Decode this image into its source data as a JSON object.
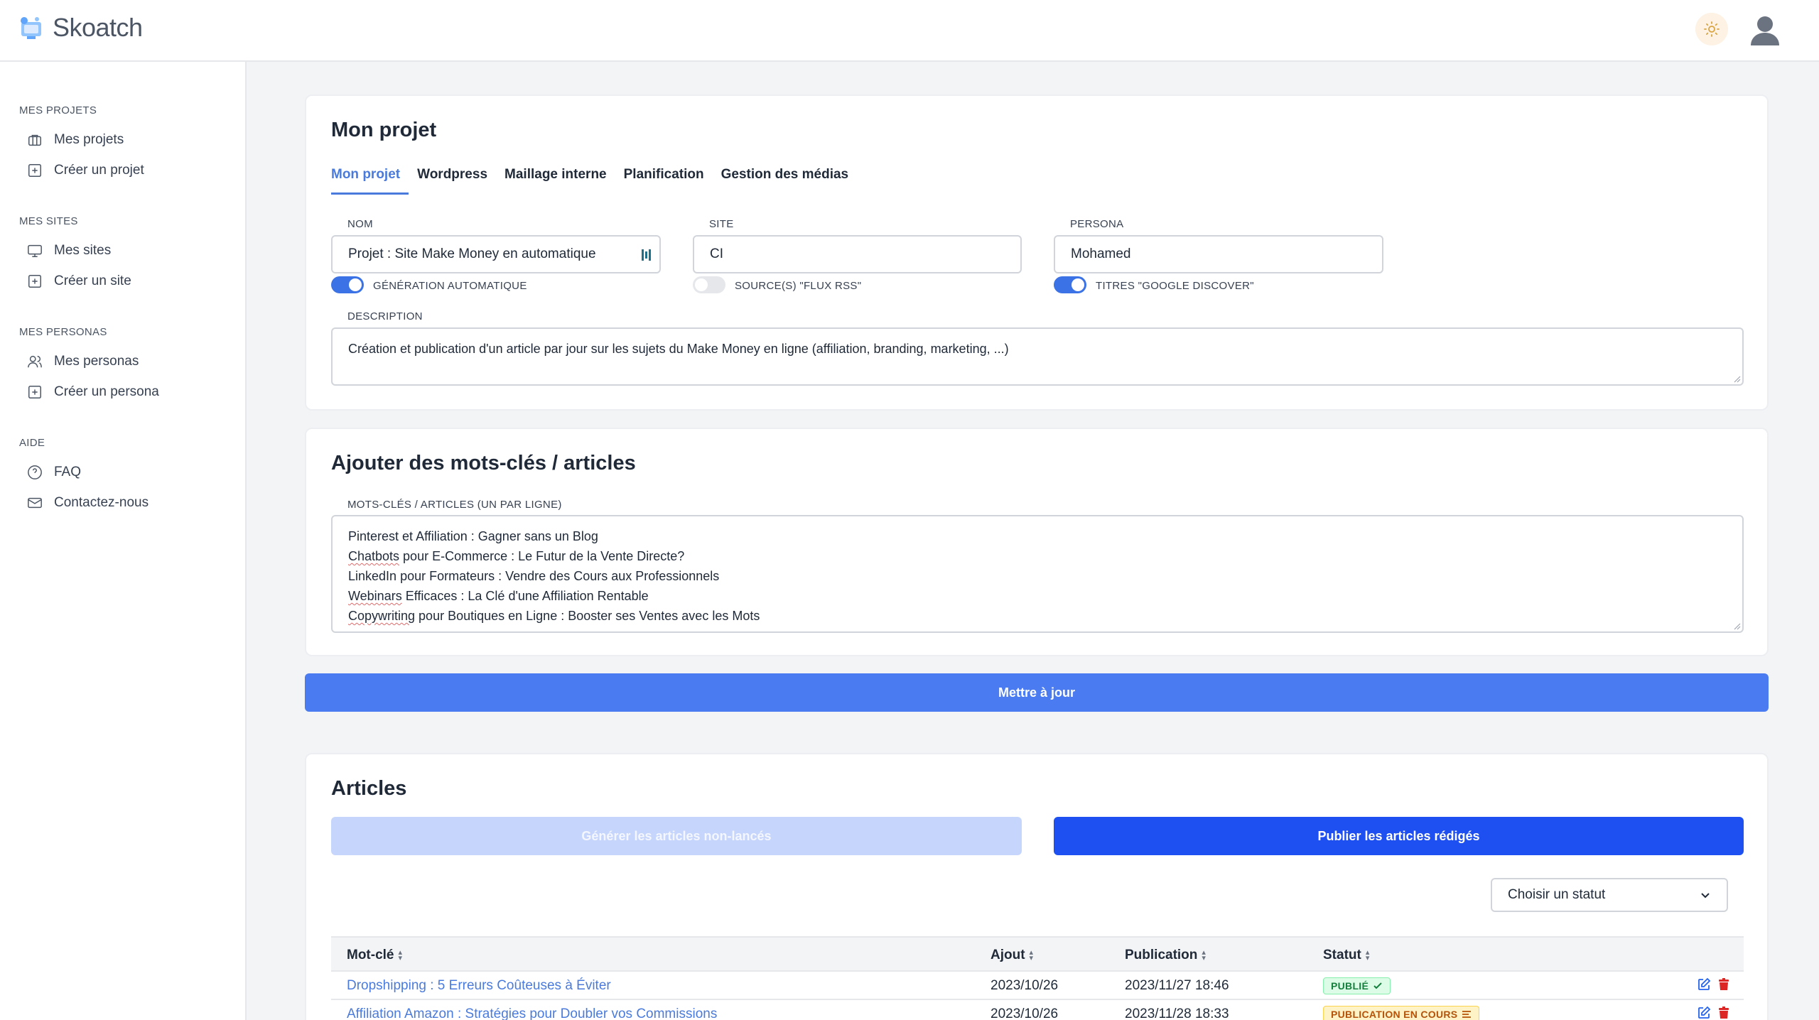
{
  "app": {
    "name": "Skoatch"
  },
  "sidebar": {
    "sections": [
      {
        "title": "MES PROJETS",
        "items": [
          {
            "label": "Mes projets",
            "icon": "briefcase-icon"
          },
          {
            "label": "Créer un projet",
            "icon": "plus-square-icon"
          }
        ]
      },
      {
        "title": "MES SITES",
        "items": [
          {
            "label": "Mes sites",
            "icon": "monitor-icon"
          },
          {
            "label": "Créer un site",
            "icon": "plus-square-icon"
          }
        ]
      },
      {
        "title": "MES PERSONAS",
        "items": [
          {
            "label": "Mes personas",
            "icon": "users-icon"
          },
          {
            "label": "Créer un persona",
            "icon": "plus-square-icon"
          }
        ]
      },
      {
        "title": "AIDE",
        "items": [
          {
            "label": "FAQ",
            "icon": "help-circle-icon"
          },
          {
            "label": "Contactez-nous",
            "icon": "mail-icon"
          }
        ]
      }
    ]
  },
  "project": {
    "title": "Mon projet",
    "tabs": [
      {
        "label": "Mon projet",
        "active": true
      },
      {
        "label": "Wordpress"
      },
      {
        "label": "Maillage interne"
      },
      {
        "label": "Planification"
      },
      {
        "label": "Gestion des médias"
      }
    ],
    "fields": {
      "nom": {
        "label": "NOM",
        "value": "Projet : Site Make Money en automatique"
      },
      "site": {
        "label": "SITE",
        "value": "CI"
      },
      "persona": {
        "label": "PERSONA",
        "value": "Mohamed"
      }
    },
    "toggles": {
      "auto": {
        "label": "GÉNÉRATION AUTOMATIQUE",
        "on": true
      },
      "rss": {
        "label": "SOURCE(S) \"FLUX RSS\"",
        "on": false
      },
      "discover": {
        "label": "TITRES \"GOOGLE DISCOVER\"",
        "on": true
      }
    },
    "description": {
      "label": "DESCRIPTION",
      "value": "Création et publication d'un article par jour sur les sujets du Make Money en ligne (affiliation, branding, marketing, ...)"
    }
  },
  "keywords": {
    "title": "Ajouter des mots-clés / articles",
    "label": "MOTS-CLÉS / ARTICLES (UN PAR LIGNE)",
    "lines": [
      {
        "first": "Pinterest",
        "rest": " et Affiliation : Gagner sans un Blog",
        "flag": false
      },
      {
        "first": "Chatbots",
        "rest": " pour E-Commerce : Le Futur de la Vente Directe?",
        "flag": true
      },
      {
        "first": "LinkedIn",
        "rest": " pour Formateurs : Vendre des Cours aux Professionnels",
        "flag": false
      },
      {
        "first": "Webinars",
        "rest": " Efficaces : La Clé d'une Affiliation Rentable",
        "flag": true
      },
      {
        "first": "Copywriting",
        "rest": " pour Boutiques en Ligne : Booster ses Ventes avec les Mots",
        "flag": true
      }
    ]
  },
  "update_button": "Mettre à jour",
  "articles": {
    "title": "Articles",
    "generate_button": "Générer les articles non-lancés",
    "publish_button": "Publier les articles rédigés",
    "status_select": "Choisir un statut",
    "columns": [
      "Mot-clé",
      "Ajout",
      "Publication",
      "Statut"
    ],
    "rows": [
      {
        "keyword": "Dropshipping : 5 Erreurs Coûteuses à Éviter",
        "added": "2023/10/26",
        "published": "2023/11/27 18:46",
        "status": "PUBLIÉ",
        "status_type": "green"
      },
      {
        "keyword": "Affiliation Amazon : Stratégies pour Doubler vos Commissions",
        "added": "2023/10/26",
        "published": "2023/11/28 18:33",
        "status": "PUBLICATION EN COURS",
        "status_type": "orange"
      }
    ]
  },
  "colors": {
    "accent": "#4a7bdc",
    "primary": "#1e4ff0",
    "update": "#4a7bf0"
  }
}
